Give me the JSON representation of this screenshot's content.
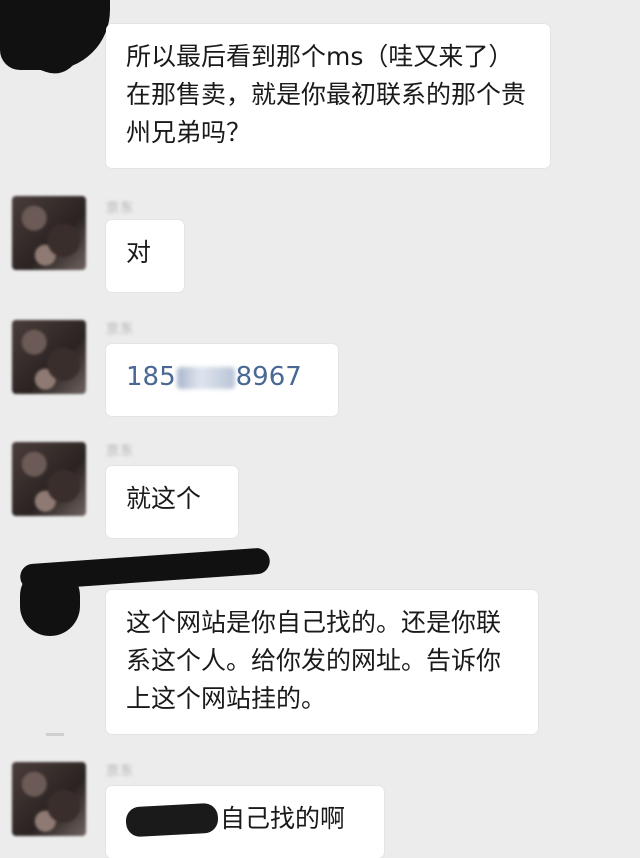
{
  "messages": [
    {
      "text": "所以最后看到那个ms（哇又来了）在那售卖，就是你最初联系的那个贵州兄弟吗？"
    },
    {
      "sender": "京东",
      "text": "对"
    },
    {
      "sender": "京东",
      "phone_prefix": "185",
      "phone_suffix": "8967",
      "phone_masked": "xxx4"
    },
    {
      "sender": "京东",
      "text": "就这个"
    },
    {
      "text": "这个网站是你自己找的。还是你联系这个人。给你发的网址。告诉你上这个网站挂的。"
    },
    {
      "sender": "京东",
      "text": "自己找的啊"
    }
  ],
  "colors": {
    "background": "#ececec",
    "bubble": "#ffffff",
    "phone_link": "#4a6894"
  }
}
